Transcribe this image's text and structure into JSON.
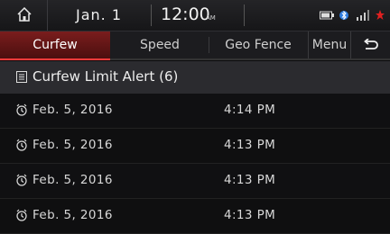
{
  "status": {
    "date": "Jan. 1",
    "time": "12:00",
    "ampm": "AM",
    "icons": [
      "battery-icon",
      "bluetooth-icon",
      "signal-icon",
      "notification-icon"
    ]
  },
  "tabs": [
    {
      "label": "Curfew",
      "selected": true
    },
    {
      "label": "Speed",
      "selected": false
    },
    {
      "label": "Geo Fence",
      "selected": false
    },
    {
      "label": "Menu",
      "selected": false
    }
  ],
  "header": {
    "title": "Curfew Limit Alert (6)"
  },
  "alerts": [
    {
      "date": "Feb. 5, 2016",
      "time": "4:14 PM"
    },
    {
      "date": "Feb. 5, 2016",
      "time": "4:13 PM"
    },
    {
      "date": "Feb. 5, 2016",
      "time": "4:13 PM"
    },
    {
      "date": "Feb. 5, 2016",
      "time": "4:13 PM"
    }
  ],
  "colors": {
    "accent": "#ff3b3b",
    "selected_tab_bg": "#7a1d1d",
    "background": "#0c0c0d"
  }
}
